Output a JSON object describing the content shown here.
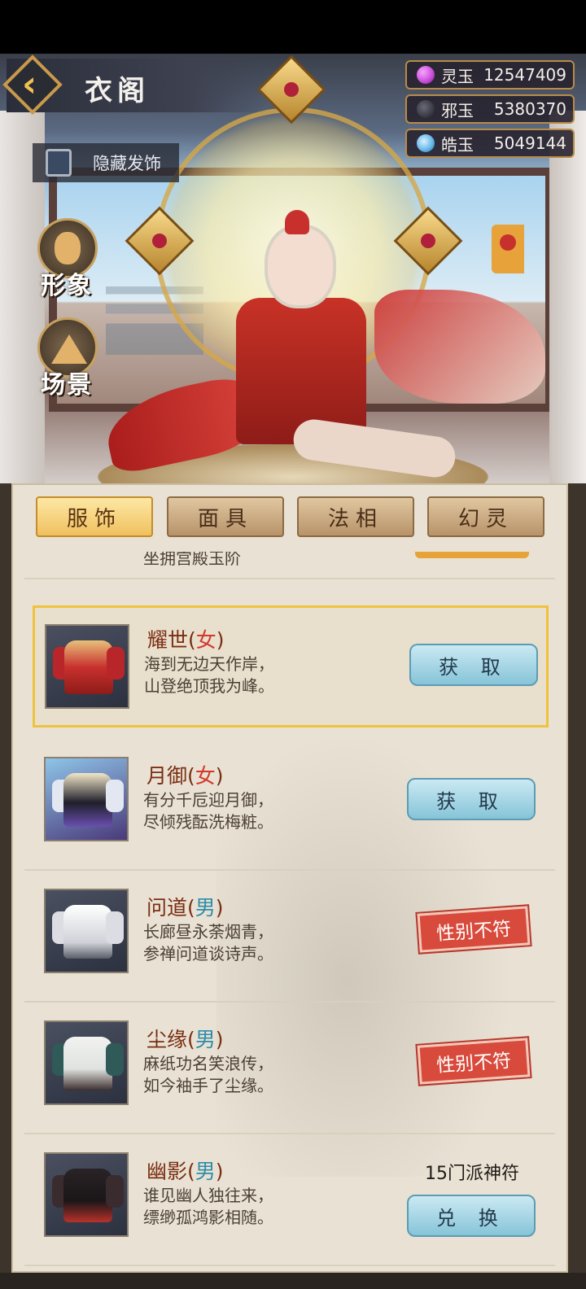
{
  "header": {
    "title": "衣阁",
    "hide_label": "隐藏发饰"
  },
  "currencies": [
    {
      "label": "灵玉",
      "value": "12547409",
      "icon": "pink-orb-icon",
      "color": "#c74bd6"
    },
    {
      "label": "邪玉",
      "value": "5380370",
      "icon": "dark-swirl-icon",
      "color": "#2d2d3a"
    },
    {
      "label": "皓玉",
      "value": "5049144",
      "icon": "blue-swirl-icon",
      "color": "#5fb3e6"
    }
  ],
  "side_buttons": [
    {
      "label": "形象",
      "icon": "portrait-icon"
    },
    {
      "label": "场景",
      "icon": "mountain-icon"
    }
  ],
  "tabs": [
    {
      "label": "服饰",
      "active": true
    },
    {
      "label": "面具",
      "active": false
    },
    {
      "label": "法相",
      "active": false
    },
    {
      "label": "幻灵",
      "active": false
    }
  ],
  "items": [
    {
      "partial": true,
      "desc_line2": "坐拥宫殿玉阶"
    },
    {
      "name": "耀世",
      "gender": "女",
      "desc_line1": "海到无边天作岸，",
      "desc_line2": "山登绝顶我为峰。",
      "action": "获 取",
      "selected": true,
      "colors": [
        "#c8302e",
        "#e8c07a"
      ]
    },
    {
      "name": "月御",
      "gender": "女",
      "desc_line1": "有分千卮迎月御，",
      "desc_line2": "尽倾残酝洗梅粧。",
      "action": "获 取",
      "colors": [
        "#6a4fb0",
        "#e3e7f2"
      ]
    },
    {
      "name": "问道",
      "gender": "男",
      "desc_line1": "长廊昼永荼烟青，",
      "desc_line2": "参禅问道谈诗声。",
      "status": "性别不符",
      "colors": [
        "#f1f1f3",
        "#9aa0ab"
      ]
    },
    {
      "name": "尘缘",
      "gender": "男",
      "desc_line1": "麻纸功名笑浪传，",
      "desc_line2": "如今袖手了尘缘。",
      "status": "性别不符",
      "colors": [
        "#eef0ee",
        "#2f5a58"
      ]
    },
    {
      "name": "幽影",
      "gender": "男",
      "desc_line1": "谁见幽人独往来，",
      "desc_line2": "缥缈孤鸿影相随。",
      "price": "15门派神符",
      "action": "兑 换",
      "colors": [
        "#2a2326",
        "#b8322a"
      ]
    }
  ]
}
